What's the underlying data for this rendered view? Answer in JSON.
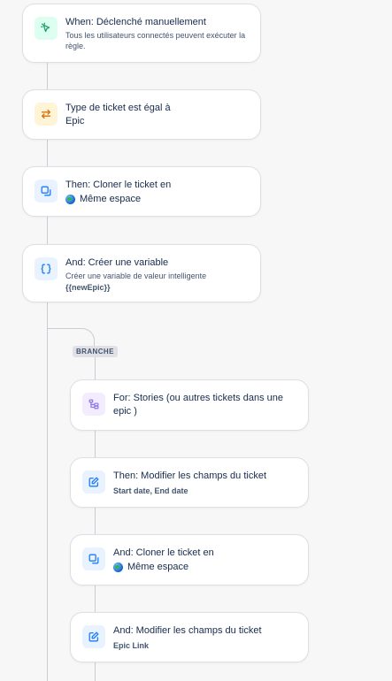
{
  "colors": {
    "trigger_icon": "#22a06b",
    "condition_icon": "#d97008",
    "action_icon": "#1d7afc",
    "branch_icon": "#8f7ee7"
  },
  "steps": [
    {
      "icon": "cursor-click-icon",
      "title": "When: Déclenché manuellement",
      "subtitle": "Tous les utilisateurs connectés peuvent exécuter la règle."
    },
    {
      "icon": "swap-arrows-icon",
      "title": "Type de ticket est égal à",
      "detail": "Epic"
    },
    {
      "icon": "clone-icon",
      "title": "Then: Cloner le ticket en",
      "detail": "Même espace"
    },
    {
      "icon": "braces-icon",
      "title": "And: Créer une variable",
      "subtitle": "Créer une variable de valeur intelligente",
      "detail": "{{newEpic}}"
    }
  ],
  "branch": {
    "label": "BRANCHE",
    "steps": [
      {
        "icon": "branch-tree-icon",
        "title": "For: Stories (ou autres tickets dans une epic )"
      },
      {
        "icon": "edit-icon",
        "title": "Then: Modifier les champs du ticket",
        "detail": "Start date, End date"
      },
      {
        "icon": "clone-icon",
        "title": "And: Cloner le ticket en",
        "detail": "Même espace"
      },
      {
        "icon": "edit-icon",
        "title": "And: Modifier les champs du ticket",
        "detail": "Epic Link"
      }
    ]
  }
}
